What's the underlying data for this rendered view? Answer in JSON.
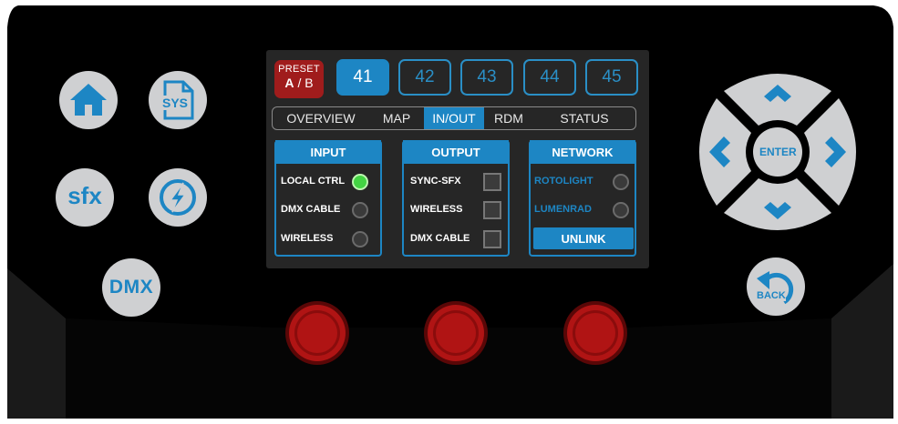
{
  "left_buttons": {
    "home": {
      "icon": "home-icon"
    },
    "sys": {
      "label": "SYS",
      "icon": "sys-file-icon"
    },
    "sfx": {
      "label": "sfx"
    },
    "lightning": {
      "icon": "lightning-icon"
    },
    "dmx": {
      "label": "DMX"
    }
  },
  "preset": {
    "title": "PRESET",
    "a": "A",
    "sep": "/",
    "b": "B"
  },
  "channels": [
    {
      "label": "41",
      "active": true
    },
    {
      "label": "42"
    },
    {
      "label": "43"
    },
    {
      "label": "44"
    },
    {
      "label": "45"
    }
  ],
  "tabs": [
    {
      "label": "OVERVIEW"
    },
    {
      "label": "MAP"
    },
    {
      "label": "IN/OUT",
      "active": true
    },
    {
      "label": "RDM"
    },
    {
      "label": "STATUS"
    }
  ],
  "input": {
    "title": "INPUT",
    "rows": [
      {
        "label": "LOCAL CTRL",
        "on": true
      },
      {
        "label": "DMX CABLE",
        "on": false
      },
      {
        "label": "WIRELESS",
        "on": false
      }
    ]
  },
  "output": {
    "title": "OUTPUT",
    "rows": [
      {
        "label": "SYNC-SFX"
      },
      {
        "label": "WIRELESS"
      },
      {
        "label": "DMX CABLE"
      }
    ]
  },
  "network": {
    "title": "NETWORK",
    "rows": [
      {
        "label": "ROTOLIGHT"
      },
      {
        "label": "LUMENRAD"
      }
    ],
    "unlink": "UNLINK"
  },
  "dpad": {
    "enter": "ENTER"
  },
  "back": {
    "label": "BACK"
  },
  "colors": {
    "accent": "#1d86c4",
    "icon_blue": "#2a8fc6",
    "preset_red": "#a01c1c",
    "led_green": "#43d443",
    "knob_red": "#b01414",
    "button_grey": "#cfd0d2"
  }
}
